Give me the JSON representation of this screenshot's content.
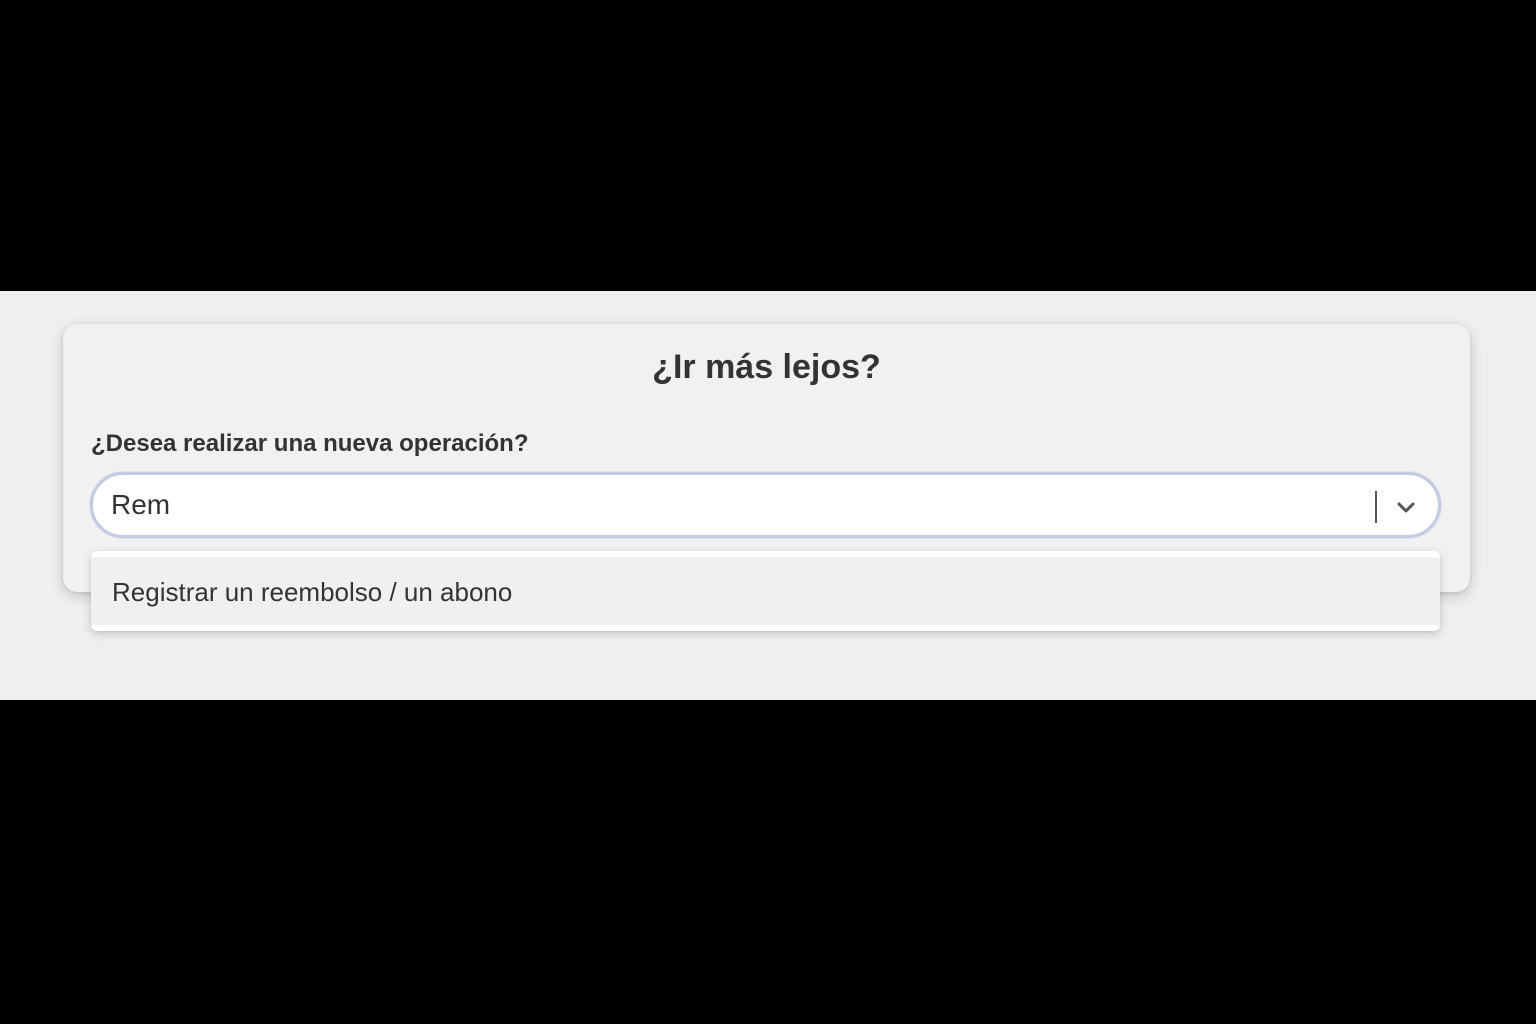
{
  "card": {
    "title": "¿Ir más lejos?",
    "field_label": "¿Desea realizar una nueva operación?"
  },
  "select": {
    "value": "Rem",
    "toggle_icon": "chevron-down-icon"
  },
  "dropdown": {
    "options": [
      {
        "label": "Registrar un reembolso / un abono"
      }
    ]
  },
  "colors": {
    "page_background": "#000000",
    "content_background": "#efefef",
    "card_background": "#f1f1f1",
    "focus_border": "#c3cbe3",
    "text": "#333333"
  }
}
